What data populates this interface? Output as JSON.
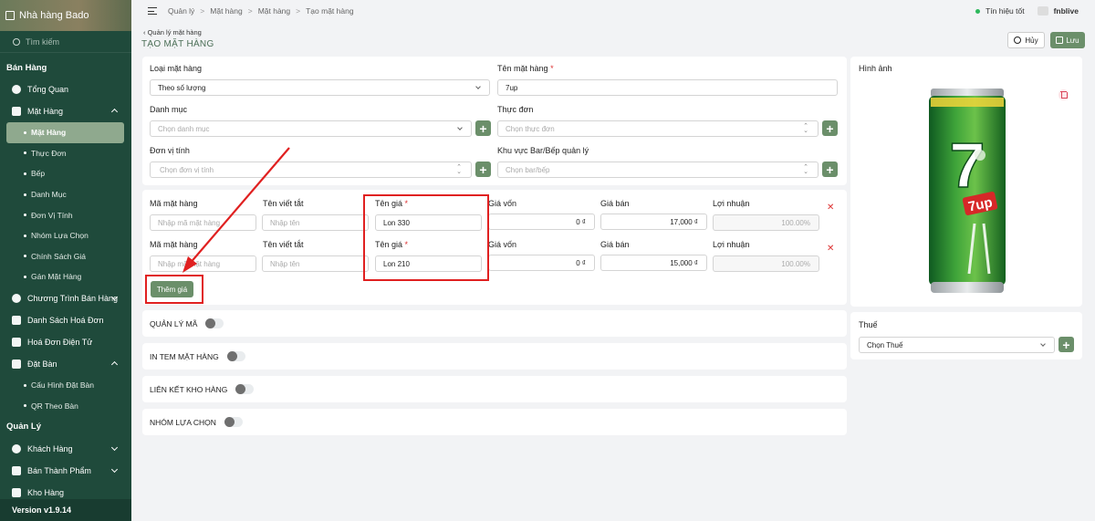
{
  "sidebar": {
    "restaurant": "Nhà hàng Bado",
    "search_placeholder": "Tìm kiếm",
    "section_sales": "Bán Hàng",
    "items": [
      {
        "label": "Tổng Quan"
      },
      {
        "label": "Mặt Hàng"
      }
    ],
    "sub_items": [
      "Mặt Hàng",
      "Thực Đơn",
      "Bếp",
      "Danh Mục",
      "Đơn Vị Tính",
      "Nhóm Lựa Chọn",
      "Chính Sách Giá",
      "Gán Mặt Hàng"
    ],
    "items2": [
      "Chương Trình Bán Hàng",
      "Danh Sách Hoá Đơn",
      "Hoá Đơn Điện Tử",
      "Đặt Bàn"
    ],
    "booking_sub": [
      "Cấu Hình Đặt Bàn",
      "QR Theo Bàn"
    ],
    "section_manage": "Quản Lý",
    "manage_items": [
      "Khách Hàng",
      "Bán Thành Phẩm",
      "Kho Hàng"
    ],
    "version": "Version v1.9.14"
  },
  "topbar": {
    "breadcrumb": [
      "Quản lý",
      "Mặt hàng",
      "Mặt hàng",
      "Tạo mặt hàng"
    ],
    "signal": "Tín hiệu tốt",
    "user": "fnblive"
  },
  "header": {
    "back": "Quản lý mặt hàng",
    "title": "TẠO MẶT HÀNG",
    "cancel": "Hủy",
    "save": "Lưu"
  },
  "form": {
    "type_label": "Loại mặt hàng",
    "type_value": "Theo số lượng",
    "name_label": "Tên mặt hàng",
    "name_value": "7up",
    "category_label": "Danh mục",
    "category_placeholder": "Chọn danh mục",
    "menu_label": "Thực đơn",
    "menu_placeholder": "Chọn thực đơn",
    "unit_label": "Đơn vị tính",
    "unit_placeholder": "Chọn đơn vị tính",
    "area_label": "Khu vực Bar/Bếp quản lý",
    "area_placeholder": "Chọn bar/bếp"
  },
  "prices": {
    "col_code": "Mã mặt hàng",
    "col_short": "Tên viết tắt",
    "col_name": "Tên giá",
    "col_cost": "Giá vốn",
    "col_sell": "Giá bán",
    "col_profit": "Lợi nhuận",
    "code_placeholder": "Nhập mã mặt hàng",
    "short_placeholder": "Nhập tên",
    "rows": [
      {
        "name": "Lon 330",
        "cost": "0 ₫",
        "sell": "17,000 ₫",
        "profit": "100.00%"
      },
      {
        "name": "Lon 210",
        "cost": "0 ₫",
        "sell": "15,000 ₫",
        "profit": "100.00%"
      }
    ],
    "add_button": "Thêm giá",
    "delete_symbol": "✕"
  },
  "toggles": [
    "QUẢN LÝ MÃ",
    "IN TEM MẶT HÀNG",
    "LIÊN KẾT KHO HÀNG",
    "NHÓM LỰA CHỌN"
  ],
  "image_panel": {
    "label": "Hình ảnh",
    "can_logo": "7up"
  },
  "tax_panel": {
    "label": "Thuế",
    "placeholder": "Chọn Thuế"
  },
  "colors": {
    "sidebar": "#1f4a3b",
    "accent": "#6b8f6a",
    "highlight": "#e02020"
  }
}
